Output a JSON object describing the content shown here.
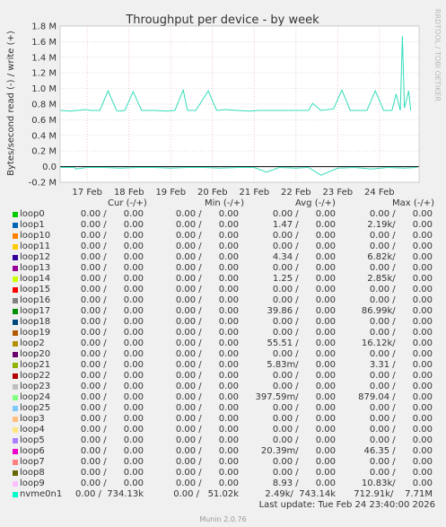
{
  "chart_data": {
    "type": "line",
    "title": "Throughput per device - by week",
    "ylabel": "Bytes/second read (-) / write (+)",
    "side_label": "RRDTOOL / TOBI OETIKER",
    "ylim": [
      -0.2,
      1.8
    ],
    "yticks": [
      "1.8 M",
      "1.6 M",
      "1.4 M",
      "1.2 M",
      "1.0 M",
      "0.8 M",
      "0.6 M",
      "0.4 M",
      "0.2 M",
      "0.0",
      "-0.2 M"
    ],
    "ytick_values": [
      1.8,
      1.6,
      1.4,
      1.2,
      1.0,
      0.8,
      0.6,
      0.4,
      0.2,
      0.0,
      -0.2
    ],
    "xticks": [
      "17 Feb",
      "18 Feb",
      "19 Feb",
      "20 Feb",
      "21 Feb",
      "22 Feb",
      "23 Feb",
      "24 Feb"
    ],
    "xrange_days": [
      16.35,
      24.95
    ],
    "series": [
      {
        "name": "nvme0n1 write",
        "color": "#33ddbb",
        "x": [
          16.35,
          16.6,
          16.95,
          17.1,
          17.3,
          17.5,
          17.7,
          17.75,
          17.9,
          18.1,
          18.3,
          18.6,
          18.9,
          19.1,
          19.3,
          19.4,
          19.6,
          19.9,
          20.1,
          20.3,
          20.6,
          20.9,
          21.1,
          21.3,
          21.5,
          21.6,
          21.8,
          22.1,
          22.3,
          22.4,
          22.6,
          22.9,
          23.1,
          23.3,
          23.5,
          23.7,
          23.9,
          24.1,
          24.3,
          24.4,
          24.5,
          24.55,
          24.6,
          24.7,
          24.75
        ],
        "values": [
          0.72,
          0.71,
          0.73,
          0.72,
          0.72,
          0.97,
          0.72,
          0.71,
          0.72,
          0.96,
          0.72,
          0.72,
          0.71,
          0.72,
          0.98,
          0.72,
          0.72,
          0.97,
          0.72,
          0.73,
          0.72,
          0.71,
          0.72,
          0.72,
          0.72,
          0.72,
          0.72,
          0.72,
          0.72,
          0.81,
          0.72,
          0.74,
          0.98,
          0.72,
          0.72,
          0.72,
          0.97,
          0.72,
          0.72,
          0.93,
          0.72,
          1.67,
          0.75,
          0.97,
          0.72
        ]
      },
      {
        "name": "nvme0n1 read",
        "color": "#33ddbb",
        "x": [
          16.35,
          16.7,
          16.72,
          17.0,
          17.4,
          17.8,
          18.2,
          18.6,
          19.0,
          19.4,
          19.8,
          20.2,
          20.6,
          21.0,
          21.3,
          21.6,
          22.0,
          22.3,
          22.6,
          23.0,
          23.4,
          23.8,
          24.2,
          24.6,
          24.9
        ],
        "values": [
          -0.01,
          -0.01,
          -0.03,
          -0.01,
          -0.01,
          -0.02,
          -0.01,
          -0.01,
          -0.02,
          -0.01,
          -0.01,
          -0.02,
          -0.01,
          -0.01,
          -0.07,
          -0.01,
          -0.02,
          -0.01,
          -0.11,
          -0.02,
          -0.01,
          -0.03,
          -0.01,
          -0.02,
          -0.01
        ]
      }
    ]
  },
  "legend": {
    "headers": {
      "cur": "Cur (-/+)",
      "min": "Min (-/+)",
      "avg": "Avg (-/+)",
      "max": "Max (-/+)"
    },
    "rows": [
      {
        "name": "loop0",
        "color": "#00cc00",
        "cur": "0.00 /      0.00",
        "min": "0.00 /      0.00",
        "avg": "0.00 /      0.00",
        "max": "0.00 /      0.00"
      },
      {
        "name": "loop1",
        "color": "#0066b3",
        "cur": "0.00 /      0.00",
        "min": "0.00 /      0.00",
        "avg": "1.47 /      0.00",
        "max": "2.19k/      0.00"
      },
      {
        "name": "loop10",
        "color": "#ff8000",
        "cur": "0.00 /      0.00",
        "min": "0.00 /      0.00",
        "avg": "0.00 /      0.00",
        "max": "0.00 /      0.00"
      },
      {
        "name": "loop11",
        "color": "#ffcc00",
        "cur": "0.00 /      0.00",
        "min": "0.00 /      0.00",
        "avg": "0.00 /      0.00",
        "max": "0.00 /      0.00"
      },
      {
        "name": "loop12",
        "color": "#330099",
        "cur": "0.00 /      0.00",
        "min": "0.00 /      0.00",
        "avg": "4.34 /      0.00",
        "max": "6.82k/      0.00"
      },
      {
        "name": "loop13",
        "color": "#990099",
        "cur": "0.00 /      0.00",
        "min": "0.00 /      0.00",
        "avg": "0.00 /      0.00",
        "max": "0.00 /      0.00"
      },
      {
        "name": "loop14",
        "color": "#ccff00",
        "cur": "0.00 /      0.00",
        "min": "0.00 /      0.00",
        "avg": "1.25 /      0.00",
        "max": "2.85k/      0.00"
      },
      {
        "name": "loop15",
        "color": "#ff0000",
        "cur": "0.00 /      0.00",
        "min": "0.00 /      0.00",
        "avg": "0.00 /      0.00",
        "max": "0.00 /      0.00"
      },
      {
        "name": "loop16",
        "color": "#808080",
        "cur": "0.00 /      0.00",
        "min": "0.00 /      0.00",
        "avg": "0.00 /      0.00",
        "max": "0.00 /      0.00"
      },
      {
        "name": "loop17",
        "color": "#008f00",
        "cur": "0.00 /      0.00",
        "min": "0.00 /      0.00",
        "avg": "39.86 /      0.00",
        "max": "86.99k/      0.00"
      },
      {
        "name": "loop18",
        "color": "#00487d",
        "cur": "0.00 /      0.00",
        "min": "0.00 /      0.00",
        "avg": "0.00 /      0.00",
        "max": "0.00 /      0.00"
      },
      {
        "name": "loop19",
        "color": "#b35a00",
        "cur": "0.00 /      0.00",
        "min": "0.00 /      0.00",
        "avg": "0.00 /      0.00",
        "max": "0.00 /      0.00"
      },
      {
        "name": "loop2",
        "color": "#b38f00",
        "cur": "0.00 /      0.00",
        "min": "0.00 /      0.00",
        "avg": "55.51 /      0.00",
        "max": "16.12k/      0.00"
      },
      {
        "name": "loop20",
        "color": "#6b006b",
        "cur": "0.00 /      0.00",
        "min": "0.00 /      0.00",
        "avg": "0.00 /      0.00",
        "max": "0.00 /      0.00"
      },
      {
        "name": "loop21",
        "color": "#8fb300",
        "cur": "0.00 /      0.00",
        "min": "0.00 /      0.00",
        "avg": "5.83m/      0.00",
        "max": "3.31 /      0.00"
      },
      {
        "name": "loop22",
        "color": "#b30000",
        "cur": "0.00 /      0.00",
        "min": "0.00 /      0.00",
        "avg": "0.00 /      0.00",
        "max": "0.00 /      0.00"
      },
      {
        "name": "loop23",
        "color": "#bebebe",
        "cur": "0.00 /      0.00",
        "min": "0.00 /      0.00",
        "avg": "0.00 /      0.00",
        "max": "0.00 /      0.00"
      },
      {
        "name": "loop24",
        "color": "#80ff80",
        "cur": "0.00 /      0.00",
        "min": "0.00 /      0.00",
        "avg": "397.59m/      0.00",
        "max": "879.04 /      0.00"
      },
      {
        "name": "loop25",
        "color": "#80c9ff",
        "cur": "0.00 /      0.00",
        "min": "0.00 /      0.00",
        "avg": "0.00 /      0.00",
        "max": "0.00 /      0.00"
      },
      {
        "name": "loop3",
        "color": "#ffc080",
        "cur": "0.00 /      0.00",
        "min": "0.00 /      0.00",
        "avg": "0.00 /      0.00",
        "max": "0.00 /      0.00"
      },
      {
        "name": "loop4",
        "color": "#ffe680",
        "cur": "0.00 /      0.00",
        "min": "0.00 /      0.00",
        "avg": "0.00 /      0.00",
        "max": "0.00 /      0.00"
      },
      {
        "name": "loop5",
        "color": "#aa80ff",
        "cur": "0.00 /      0.00",
        "min": "0.00 /      0.00",
        "avg": "0.00 /      0.00",
        "max": "0.00 /      0.00"
      },
      {
        "name": "loop6",
        "color": "#ee00cc",
        "cur": "0.00 /      0.00",
        "min": "0.00 /      0.00",
        "avg": "20.39m/      0.00",
        "max": "46.35 /      0.00"
      },
      {
        "name": "loop7",
        "color": "#ff8080",
        "cur": "0.00 /      0.00",
        "min": "0.00 /      0.00",
        "avg": "0.00 /      0.00",
        "max": "0.00 /      0.00"
      },
      {
        "name": "loop8",
        "color": "#666600",
        "cur": "0.00 /      0.00",
        "min": "0.00 /      0.00",
        "avg": "0.00 /      0.00",
        "max": "0.00 /      0.00"
      },
      {
        "name": "loop9",
        "color": "#ffbfff",
        "cur": "0.00 /      0.00",
        "min": "0.00 /      0.00",
        "avg": "8.93 /      0.00",
        "max": "10.83k/      0.00"
      },
      {
        "name": "nvme0n1",
        "color": "#00ffcc",
        "cur": "0.00 /  734.13k",
        "min": "0.00 /   51.02k",
        "avg": "2.49k/  743.14k",
        "max": "712.91k/    7.71M"
      }
    ]
  },
  "footer": {
    "last_update": "Last update: Tue Feb 24 23:40:00 2026",
    "munin": "Munin 2.0.76"
  }
}
